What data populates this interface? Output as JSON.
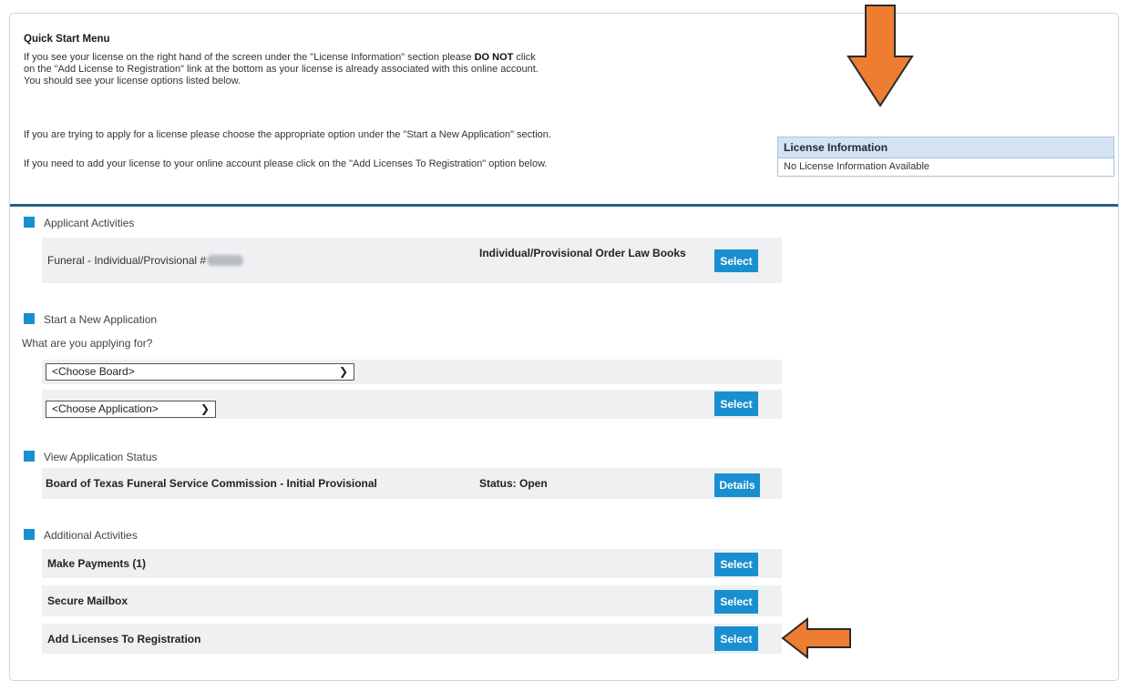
{
  "quick_start": {
    "title": "Quick Start Menu",
    "para1_l1_pre": "If you see your license on the right hand of the screen under the \"License Information\" section please ",
    "para1_l1_bold": "DO NOT",
    "para1_l1_post": " click",
    "para1_l2": "on the \"Add License to Registration\" link at the bottom as your license is already associated with this online account.",
    "para1_l3": "You should see your license options listed below.",
    "para2": "If you are trying to apply for a license please choose the appropriate option under the \"Start a New Application\" section.",
    "para3": "If you need to add your license to your online account please click on the \"Add Licenses To Registration\" option below."
  },
  "license_info": {
    "header": "License Information",
    "body": "No License Information Available"
  },
  "applicant_activities": {
    "header": "Applicant Activities",
    "item_label": "Funeral - Individual/Provisional #",
    "action_text": "Individual/Provisional Order Law Books",
    "button": "Select"
  },
  "new_application": {
    "header": "Start a New Application",
    "prompt": "What are you applying for?",
    "board_select": "<Choose Board>",
    "application_select": "<Choose Application>",
    "button": "Select"
  },
  "application_status": {
    "header": "View Application Status",
    "name": "Board of Texas Funeral Service Commission - Initial Provisional",
    "status": "Status: Open",
    "button": "Details"
  },
  "additional_activities": {
    "header": "Additional Activities",
    "items": [
      {
        "label": "Make Payments (1)",
        "button": "Select"
      },
      {
        "label": "Secure Mailbox",
        "button": "Select"
      },
      {
        "label": "Add Licenses To Registration",
        "button": "Select"
      }
    ]
  },
  "colors": {
    "accent": "#1a8fd0",
    "divider": "#23647a",
    "arrow": "#ed7d31"
  },
  "icons": [
    "section-square-icon",
    "chevron-down-icon",
    "down-arrow-annotation-icon",
    "left-arrow-annotation-icon"
  ]
}
